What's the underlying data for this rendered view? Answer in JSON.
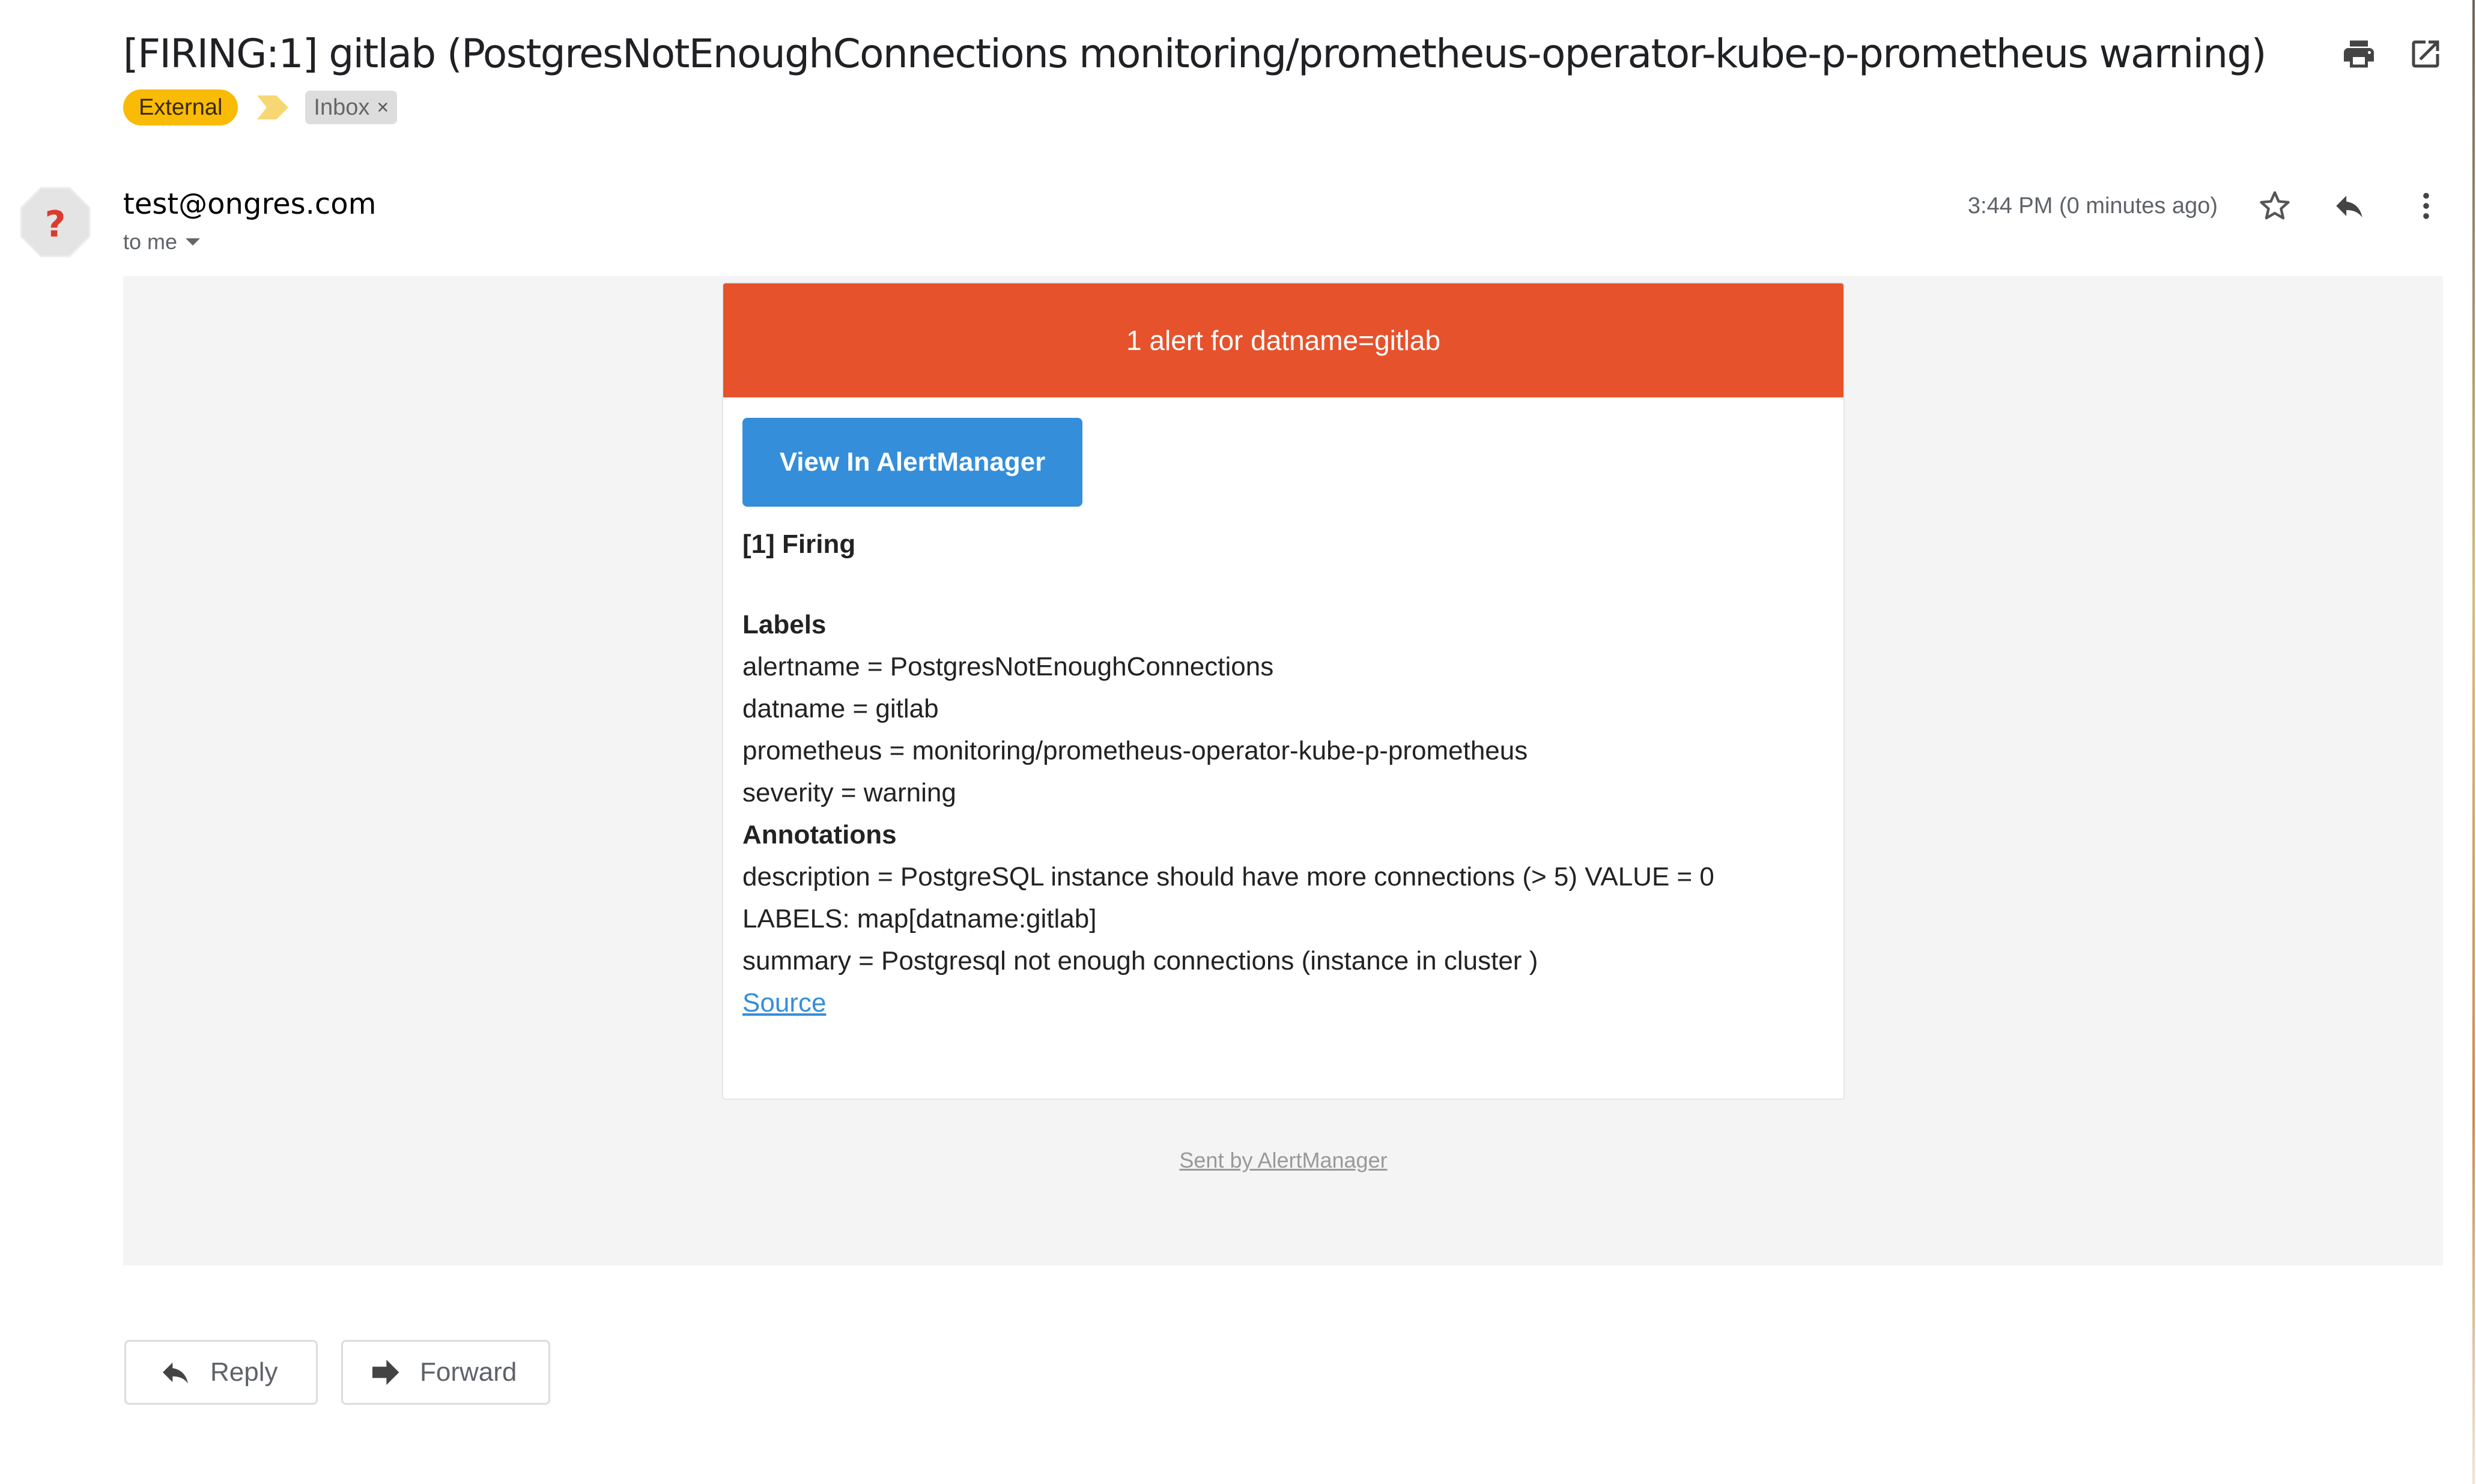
{
  "email": {
    "subject": "[FIRING:1] gitlab (PostgresNotEnoughConnections monitoring/prometheus-operator-kube-p-prometheus warning)",
    "labels": [
      {
        "name": "External",
        "color": "#f9bb06"
      },
      {
        "name": "Inbox",
        "removable": true,
        "remove_glyph": "×"
      }
    ],
    "importance_marker": "important-marker-icon",
    "top_actions": [
      {
        "name": "print-all-icon"
      },
      {
        "name": "open-in-new-window-icon"
      }
    ],
    "sender": {
      "avatar_glyph": "?",
      "address": "test@ongres.com",
      "recipient_line": "to me"
    },
    "timestamp": "3:44 PM (0 minutes ago)",
    "header_actions": [
      {
        "name": "star-icon"
      },
      {
        "name": "reply-icon"
      },
      {
        "name": "more-options-icon"
      }
    ]
  },
  "alert": {
    "header": "1 alert for datname=gitlab",
    "header_color": "#e6522c",
    "button_label": "View In AlertManager",
    "button_color": "#348eda",
    "firing_title": "[1] Firing",
    "labels_title": "Labels",
    "labels": [
      "alertname = PostgresNotEnoughConnections",
      "datname = gitlab",
      "prometheus = monitoring/prometheus-operator-kube-p-prometheus",
      "severity = warning"
    ],
    "annotations_title": "Annotations",
    "annotations": [
      "description = PostgreSQL instance should have more connections (> 5) VALUE = 0 LABELS: map[datname:gitlab]",
      "summary = Postgresql not enough connections (instance in cluster )"
    ],
    "source_link": "Source",
    "footer": "Sent by AlertManager"
  },
  "actions": {
    "reply_label": "Reply",
    "forward_label": "Forward"
  }
}
